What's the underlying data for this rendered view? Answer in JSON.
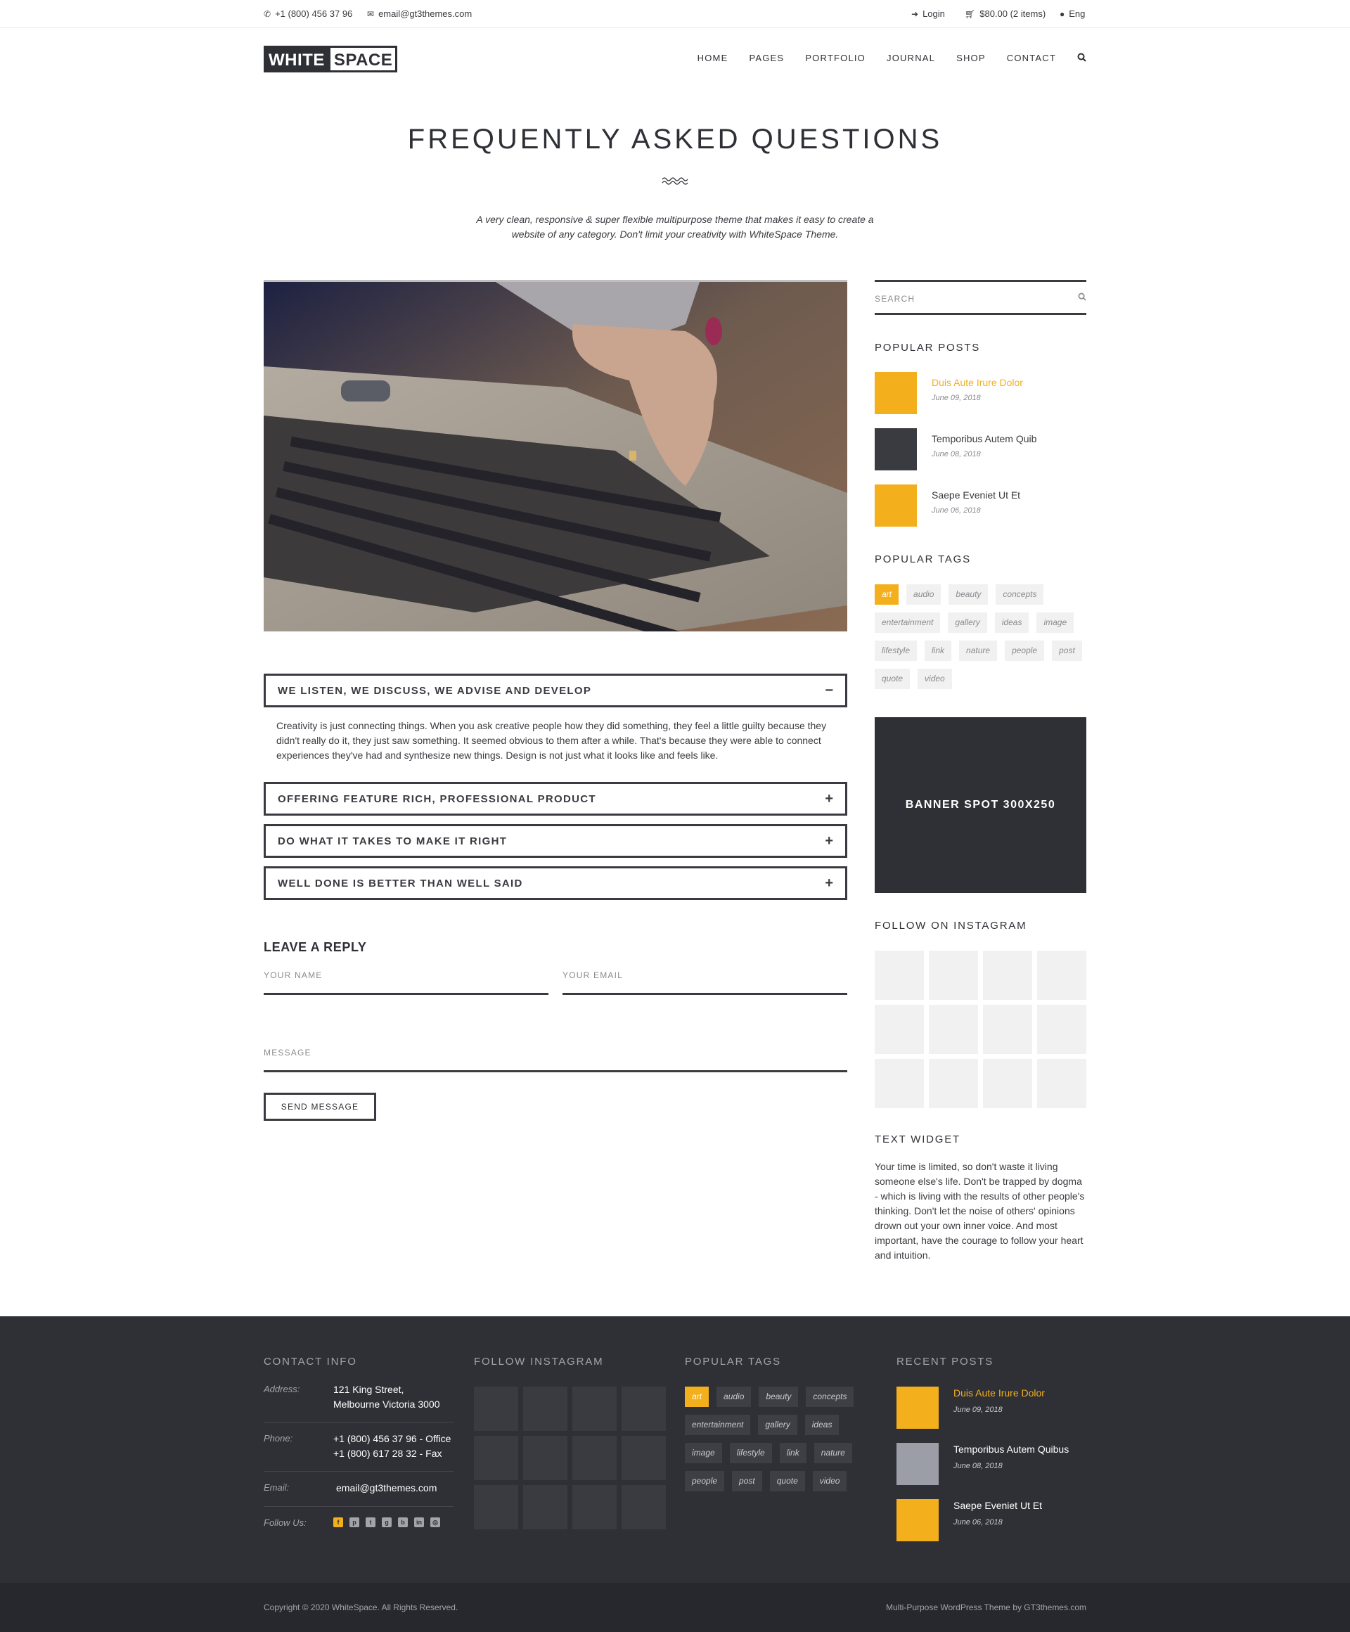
{
  "topbar": {
    "phone": "+1 (800) 456 37 96",
    "email": "email@gt3themes.com",
    "login": "Login",
    "cart": "$80.00 (2 items)",
    "lang": "Eng"
  },
  "logo": {
    "part1": "WHITE",
    "part2": "SPACE"
  },
  "nav": [
    "HOME",
    "PAGES",
    "PORTFOLIO",
    "JOURNAL",
    "SHOP",
    "CONTACT"
  ],
  "page": {
    "title": "FREQUENTLY ASKED QUESTIONS",
    "subtitle": "A very clean, responsive & super flexible multipurpose theme that makes it easy to create a website of any category. Don't limit your creativity with WhiteSpace Theme."
  },
  "faq": [
    {
      "title": "WE LISTEN, WE DISCUSS, WE ADVISE AND DEVELOP",
      "sign": "−",
      "body": "Creativity is just connecting things. When you ask creative people how they did something, they feel a little guilty because they didn't really do it, they just saw something. It seemed obvious to them after a while. That's because they were able to connect experiences they've had and synthesize new things. Design is not just what it looks like and feels like."
    },
    {
      "title": "OFFERING FEATURE RICH, PROFESSIONAL PRODUCT",
      "sign": "+"
    },
    {
      "title": "DO WHAT IT TAKES TO MAKE IT RIGHT",
      "sign": "+"
    },
    {
      "title": "WELL DONE IS BETTER THAN WELL SAID",
      "sign": "+"
    }
  ],
  "reply": {
    "title": "LEAVE A REPLY",
    "name_placeholder": "YOUR NAME",
    "email_placeholder": "YOUR EMAIL",
    "message_placeholder": "MESSAGE",
    "send_label": "SEND MESSAGE"
  },
  "sidebar": {
    "search_placeholder": "SEARCH",
    "popular_posts_title": "POPULAR POSTS",
    "posts": [
      {
        "title": "Duis Aute Irure Dolor",
        "date": "June 09, 2018",
        "color": "#f3af1c",
        "highlight": true
      },
      {
        "title": "Temporibus Autem Quib",
        "date": "June 08, 2018",
        "color": "#3a3b40",
        "highlight": false
      },
      {
        "title": "Saepe Eveniet Ut Et",
        "date": "June 06, 2018",
        "color": "#f3af1c",
        "highlight": false
      }
    ],
    "popular_tags_title": "POPULAR TAGS",
    "tags": [
      "art",
      "audio",
      "beauty",
      "concepts",
      "entertainment",
      "gallery",
      "ideas",
      "image",
      "lifestyle",
      "link",
      "nature",
      "people",
      "post",
      "quote",
      "video"
    ],
    "banner": "BANNER SPOT 300X250",
    "instagram_title": "FOLLOW ON INSTAGRAM",
    "text_widget_title": "TEXT WIDGET",
    "text_widget_body": "Your time is limited, so don't waste it living someone else's life. Don't be trapped by dogma - which is living with the results of other people's thinking. Don't let the noise of others' opinions drown out your own inner voice. And most important, have the courage to follow your heart and intuition."
  },
  "footer": {
    "contact_title": "CONTACT INFO",
    "address_label": "Address:",
    "address_line1": "121 King Street,",
    "address_line2": "Melbourne Victoria 3000",
    "phone_label": "Phone:",
    "phone_line1": "+1 (800) 456 37 96 - Office",
    "phone_line2": "+1 (800) 617 28 32 - Fax",
    "email_label": "Email:",
    "email": "email@gt3themes.com",
    "follow_label": "Follow Us:",
    "instagram_title": "FOLLOW INSTAGRAM",
    "tags_title": "POPULAR TAGS",
    "tags": [
      "art",
      "audio",
      "beauty",
      "concepts",
      "entertainment",
      "gallery",
      "ideas",
      "image",
      "lifestyle",
      "link",
      "nature",
      "people",
      "post",
      "quote",
      "video"
    ],
    "recent_title": "RECENT POSTS",
    "posts": [
      {
        "title": "Duis Aute Irure Dolor",
        "date": "June 09, 2018",
        "color": "#f3af1c",
        "highlight": true
      },
      {
        "title": "Temporibus Autem Quibus",
        "date": "June 08, 2018",
        "color": "#9c9ea7",
        "highlight": false
      },
      {
        "title": "Saepe Eveniet Ut Et",
        "date": "June 06, 2018",
        "color": "#f3af1c",
        "highlight": false
      }
    ],
    "copyright": "Copyright © 2020 WhiteSpace. All Rights Reserved.",
    "credit": "Multi-Purpose WordPress Theme by GT3themes.com"
  },
  "colors": {
    "accent": "#f3af1c",
    "dark": "#2f3036",
    "text": "#3a3b40"
  }
}
